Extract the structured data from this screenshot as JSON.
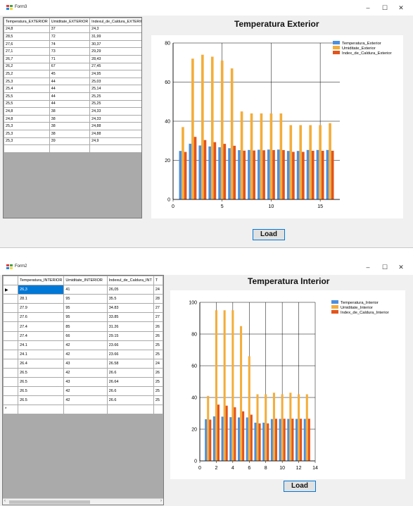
{
  "forms": [
    {
      "title": "Form3",
      "grid": {
        "has_row_header": false,
        "columns": [
          "Temperatura_EXTERIOR",
          "Umiditate_EXTERIOR",
          "Indexul_de_Caldura_EXTERIOR"
        ],
        "rows": [
          [
            "24,8",
            "37",
            "24,3"
          ],
          [
            "28,5",
            "72",
            "31,99"
          ],
          [
            "27,6",
            "74",
            "30,37"
          ],
          [
            "27,1",
            "73",
            "29,29"
          ],
          [
            "26,7",
            "71",
            "28,43"
          ],
          [
            "26,2",
            "67",
            "27,45"
          ],
          [
            "25,2",
            "45",
            "24,95"
          ],
          [
            "25,3",
            "44",
            "25,03"
          ],
          [
            "25,4",
            "44",
            "25,14"
          ],
          [
            "25,5",
            "44",
            "25,25"
          ],
          [
            "25,5",
            "44",
            "25,25"
          ],
          [
            "24,8",
            "38",
            "24,33"
          ],
          [
            "24,8",
            "38",
            "24,33"
          ],
          [
            "25,3",
            "38",
            "24,88"
          ],
          [
            "25,3",
            "38",
            "24,88"
          ],
          [
            "25,3",
            "39",
            "24,9"
          ]
        ]
      },
      "chart_title": "Temperatura Exterior",
      "chart_data": {
        "type": "bar",
        "title": "Temperatura Exterior",
        "x": [
          1,
          2,
          3,
          4,
          5,
          6,
          7,
          8,
          9,
          10,
          11,
          12,
          13,
          14,
          15,
          16
        ],
        "series": [
          {
            "name": "Temperatura_Exterior",
            "color": "#4a8fe0",
            "values": [
              24.8,
              28.5,
              27.6,
              27.1,
              26.7,
              26.2,
              25.2,
              25.3,
              25.4,
              25.5,
              25.5,
              24.8,
              24.8,
              25.3,
              25.3,
              25.3
            ]
          },
          {
            "name": "Umiditate_Exterior",
            "color": "#f4ad3a",
            "values": [
              37,
              72,
              74,
              73,
              71,
              67,
              45,
              44,
              44,
              44,
              44,
              38,
              38,
              38,
              38,
              39
            ]
          },
          {
            "name": "Index_de_Caldura_Exterior",
            "color": "#e2541c",
            "values": [
              24.3,
              31.99,
              30.37,
              29.29,
              28.43,
              27.45,
              24.95,
              25.03,
              25.14,
              25.25,
              25.25,
              24.33,
              24.33,
              24.88,
              24.88,
              24.9
            ]
          }
        ],
        "x_ticks": [
          0,
          5,
          10,
          15
        ],
        "y_ticks": [
          0,
          20,
          40,
          60,
          80
        ],
        "xlim": [
          0,
          17
        ],
        "ylim": [
          0,
          80
        ]
      },
      "load_label": "Load"
    },
    {
      "title": "Form2",
      "grid": {
        "has_row_header": true,
        "columns": [
          "Temperatura_INTERIOR",
          "Umiditate_INTERIOR",
          "Indexul_de_Caldura_INT",
          "T"
        ],
        "rows": [
          [
            "26,3",
            "41",
            "26,05",
            "24"
          ],
          [
            "28.1",
            "95",
            "35.5",
            "28"
          ],
          [
            "27.9",
            "95",
            "34.83",
            "27"
          ],
          [
            "27.6",
            "95",
            "33.85",
            "27"
          ],
          [
            "27.4",
            "85",
            "31.26",
            "26"
          ],
          [
            "27.4",
            "66",
            "29.15",
            "26"
          ],
          [
            "24.1",
            "42",
            "23.66",
            "25"
          ],
          [
            "24.1",
            "42",
            "23.66",
            "25"
          ],
          [
            "26.4",
            "43",
            "26.58",
            "24"
          ],
          [
            "26.5",
            "42",
            "26.6",
            "26"
          ],
          [
            "26.5",
            "43",
            "26.64",
            "25"
          ],
          [
            "26.5",
            "42",
            "26.6",
            "25"
          ],
          [
            "26.5",
            "42",
            "26.6",
            "25"
          ]
        ],
        "selected_row_marker": "▶",
        "new_row_marker": "*"
      },
      "chart_title": "Temperatura Interior",
      "chart_data": {
        "type": "bar",
        "title": "Temperatura Interior",
        "x": [
          1,
          2,
          3,
          4,
          5,
          6,
          7,
          8,
          9,
          10,
          11,
          12,
          13
        ],
        "series": [
          {
            "name": "Temperatura_Interior",
            "color": "#4a8fe0",
            "values": [
              26.3,
              28.1,
              27.9,
              27.6,
              27.4,
              27.4,
              24.1,
              24.1,
              26.4,
              26.5,
              26.5,
              26.5,
              26.5
            ]
          },
          {
            "name": "Umiditate_Interior",
            "color": "#f4ad3a",
            "values": [
              41,
              95,
              95,
              95,
              85,
              66,
              42,
              42,
              43,
              42,
              43,
              42,
              42
            ]
          },
          {
            "name": "Index_de_Caldura_Interior",
            "color": "#e2541c",
            "values": [
              26.05,
              35.5,
              34.83,
              33.85,
              31.26,
              29.15,
              23.66,
              23.66,
              26.58,
              26.6,
              26.64,
              26.6,
              26.6
            ]
          }
        ],
        "x_ticks": [
          0,
          2,
          4,
          6,
          8,
          10,
          12,
          14
        ],
        "y_ticks": [
          0,
          20,
          40,
          60,
          80,
          100
        ],
        "xlim": [
          0,
          14
        ],
        "ylim": [
          0,
          100
        ]
      },
      "load_label": "Load"
    }
  ]
}
